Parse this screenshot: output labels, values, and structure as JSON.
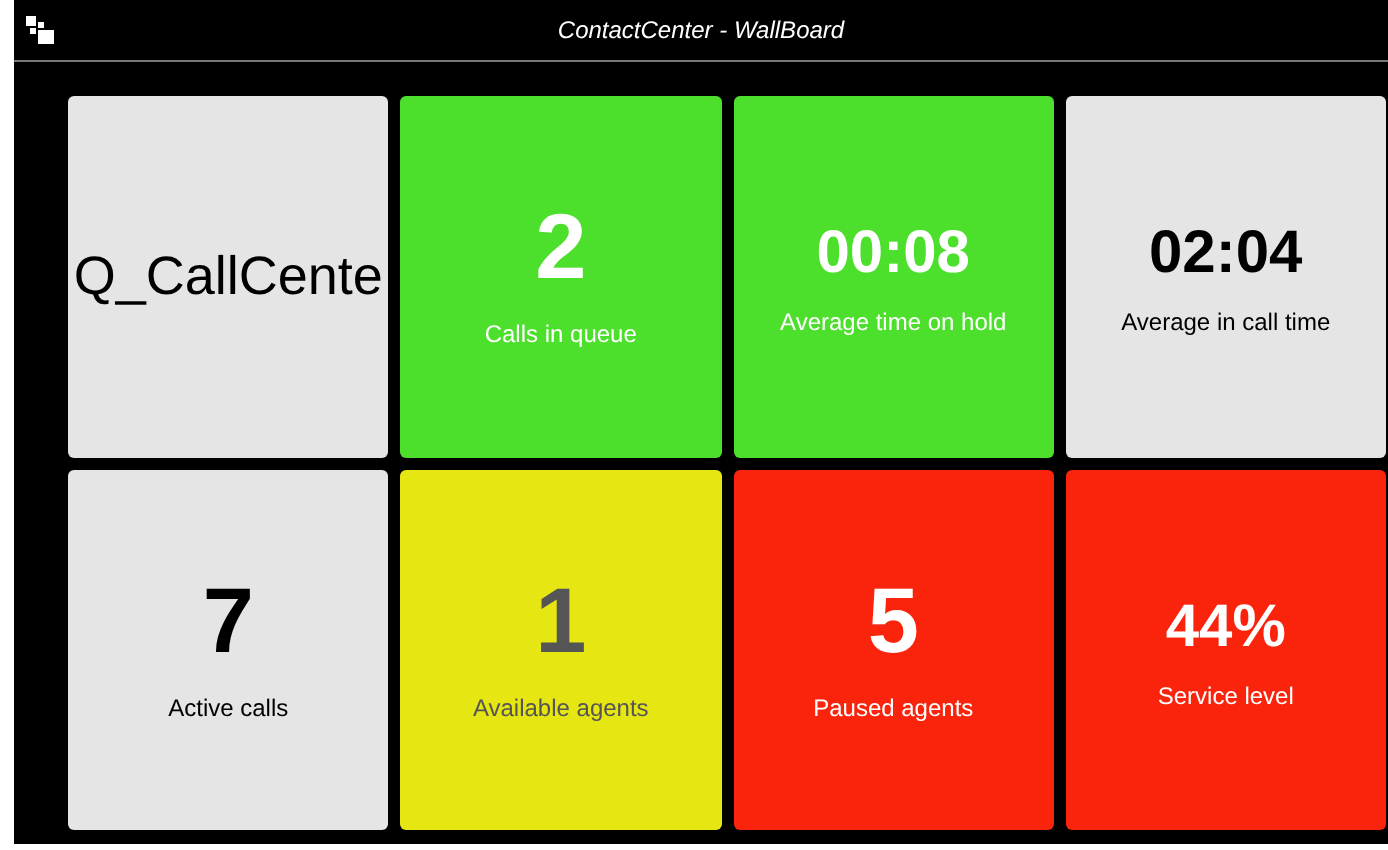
{
  "window": {
    "title": "ContactCenter - WallBoard"
  },
  "tiles": [
    {
      "kind": "name",
      "value": "Q_CallCente",
      "color": "#e5e5e5"
    },
    {
      "kind": "metric",
      "value": "2",
      "label": "Calls in queue",
      "color": "#4cdf2b"
    },
    {
      "kind": "metric",
      "value": "00:08",
      "label": "Average time on hold",
      "color": "#4cdf2b"
    },
    {
      "kind": "metric",
      "value": "02:04",
      "label": "Average in call time",
      "color": "#e5e5e5"
    },
    {
      "kind": "metric",
      "value": "7",
      "label": "Active calls",
      "color": "#e5e5e5"
    },
    {
      "kind": "metric",
      "value": "1",
      "label": "Available agents",
      "color": "#e6e612"
    },
    {
      "kind": "metric",
      "value": "5",
      "label": "Paused agents",
      "color": "#fa230c"
    },
    {
      "kind": "metric",
      "value": "44%",
      "label": "Service level",
      "color": "#fa230c"
    }
  ]
}
